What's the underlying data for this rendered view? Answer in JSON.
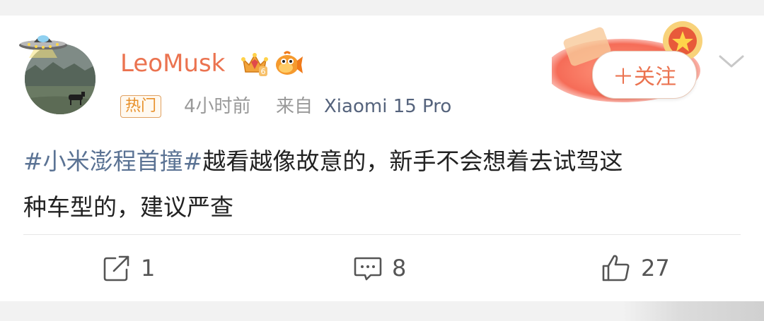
{
  "post": {
    "username": "LeoMusk",
    "hot_tag": "热门",
    "time_ago": "4小时前",
    "from_label": "来自",
    "device": "Xiaomi 15 Pro",
    "follow_label": "＋关注",
    "content": {
      "hashtag": "#小米澎程首撞#",
      "line1_rest": "越看越像故意的，新手不会想着去试驾这",
      "line2": "种车型的，建议严查"
    }
  },
  "actions": {
    "repost_count": "1",
    "comment_count": "8",
    "like_count": "27"
  },
  "icons": {
    "avatar_decoration": "ufo-icon",
    "crown_badge": "crown-icon",
    "fish_badge": "fish-icon",
    "menu": "chevron-down-icon",
    "repost": "repost-icon",
    "comment": "comment-icon",
    "like": "thumbs-up-icon"
  },
  "colors": {
    "username": "#eb7350",
    "hashtag": "#5b7394",
    "meta": "#999999",
    "device": "#55637c",
    "follow": "#eb7350"
  }
}
